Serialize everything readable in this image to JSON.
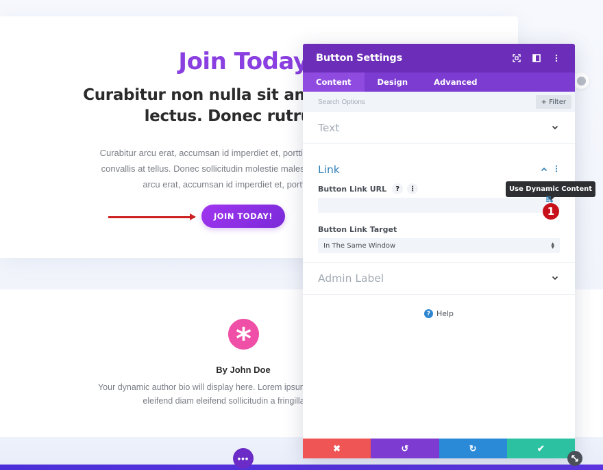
{
  "page": {
    "hero": {
      "title": "Join Today",
      "subtitle_line1": "Curabitur non nulla sit amet nisl tem",
      "subtitle_line2": "lectus. Donec rutrum c",
      "body_line1": "Curabitur arcu erat, accumsan id imperdiet et, porttitor at sem. Vivamus r",
      "body_line2": "convallis at tellus. Donec sollicitudin molestie malesuada. Pellentesque i",
      "body_line3": "arcu erat, accumsan id imperdiet et, porttitor at sen",
      "button_label": "JOIN TODAY!"
    },
    "author": {
      "avatar_glyph": "*",
      "name": "By John Doe",
      "bio_line1": "Your dynamic author bio will display here. Lorem ipsum dolor sit amet, conse",
      "bio_line2": "eleifend diam eleifend sollicitudin a fringilla turpis. Cu"
    },
    "more_label": "•••"
  },
  "modal": {
    "title": "Button Settings",
    "header_icons": [
      "focus-icon",
      "split-view-icon",
      "kebab-menu-icon"
    ],
    "tabs": [
      {
        "label": "Content",
        "active": true
      },
      {
        "label": "Design",
        "active": false
      },
      {
        "label": "Advanced",
        "active": false
      }
    ],
    "search": {
      "placeholder": "Search Options",
      "filter_label": "+ Filter"
    },
    "groups": {
      "text": {
        "title": "Text",
        "expanded": false
      },
      "link": {
        "title": "Link",
        "expanded": true,
        "url_label": "Button Link URL",
        "url_value": "",
        "target_label": "Button Link Target",
        "target_value": "In The Same Window"
      },
      "admin": {
        "title": "Admin Label",
        "expanded": false
      }
    },
    "help_label": "Help",
    "footer": {
      "cancel": "✖",
      "undo": "↺",
      "redo": "↻",
      "save": "✔"
    },
    "colors": {
      "header": "#6c2eb9",
      "tabs": "#7c3bd1",
      "cancel": "#ef5555",
      "undo": "#7d3bd1",
      "redo": "#2a8ad8",
      "save": "#2cc2a1"
    }
  },
  "tooltip": {
    "text": "Use Dynamic Content"
  },
  "annotation": {
    "step_number": "1"
  }
}
